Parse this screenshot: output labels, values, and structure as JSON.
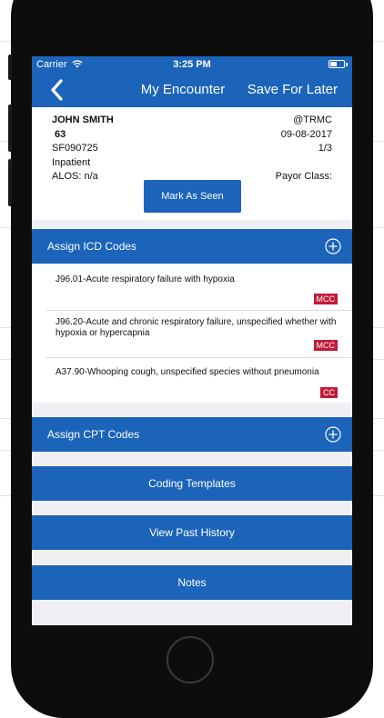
{
  "status": {
    "carrier": "Carrier",
    "time": "3:25 PM"
  },
  "nav": {
    "title": "My Encounter",
    "save_label": "Save For Later"
  },
  "patient": {
    "name": "JOHN SMITH",
    "age": "63",
    "id": "SF090725",
    "type": "Inpatient",
    "alos": "ALOS: n/a",
    "facility": "@TRMC",
    "date": "09-08-2017",
    "page": "1/3",
    "payor": "Payor Class:",
    "mark_label": "Mark As Seen"
  },
  "icd": {
    "header": "Assign ICD Codes",
    "items": [
      {
        "text": "J96.01-Acute respiratory failure with hypoxia",
        "badge": "MCC"
      },
      {
        "text": "J96.20-Acute and chronic respiratory failure, unspecified whether with hypoxia or hypercapnia",
        "badge": "MCC"
      },
      {
        "text": "A37.90-Whooping cough, unspecified species without pneumonia",
        "badge": "CC"
      }
    ]
  },
  "cpt": {
    "header": "Assign CPT Codes"
  },
  "actions": {
    "templates": "Coding Templates",
    "history": "View Past History",
    "notes": "Notes"
  },
  "colors": {
    "primary": "#1b64b9",
    "badge": "#c11a36",
    "background": "#efeff4"
  },
  "icons": [
    "back-chevron-icon",
    "wifi-icon",
    "battery-icon",
    "plus-circle-icon"
  ]
}
